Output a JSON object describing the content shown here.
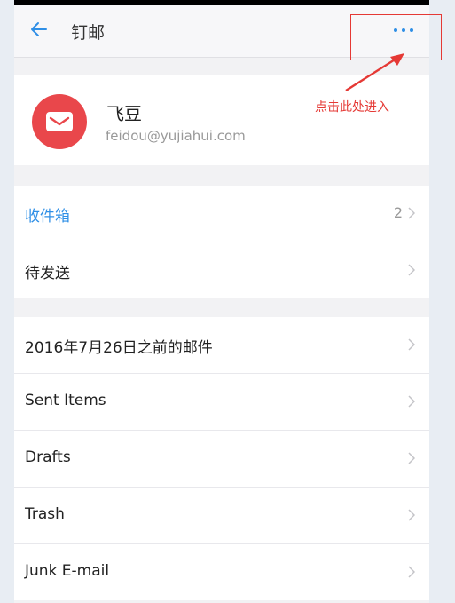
{
  "nav": {
    "title": "钉邮"
  },
  "account": {
    "name": "飞豆",
    "email": "feidou@yujiahui.com"
  },
  "group1": [
    {
      "label": "收件箱",
      "count": "2"
    },
    {
      "label": "待发送",
      "count": ""
    }
  ],
  "group2": [
    {
      "label": "2016年7月26日之前的邮件"
    },
    {
      "label": "Sent Items"
    },
    {
      "label": "Drafts"
    },
    {
      "label": "Trash"
    },
    {
      "label": "Junk E-mail"
    }
  ],
  "annotation": {
    "text": "点击此处进入"
  },
  "colors": {
    "accent": "#2f8fe6",
    "avatar": "#e9474b",
    "annotation": "#e53935"
  }
}
